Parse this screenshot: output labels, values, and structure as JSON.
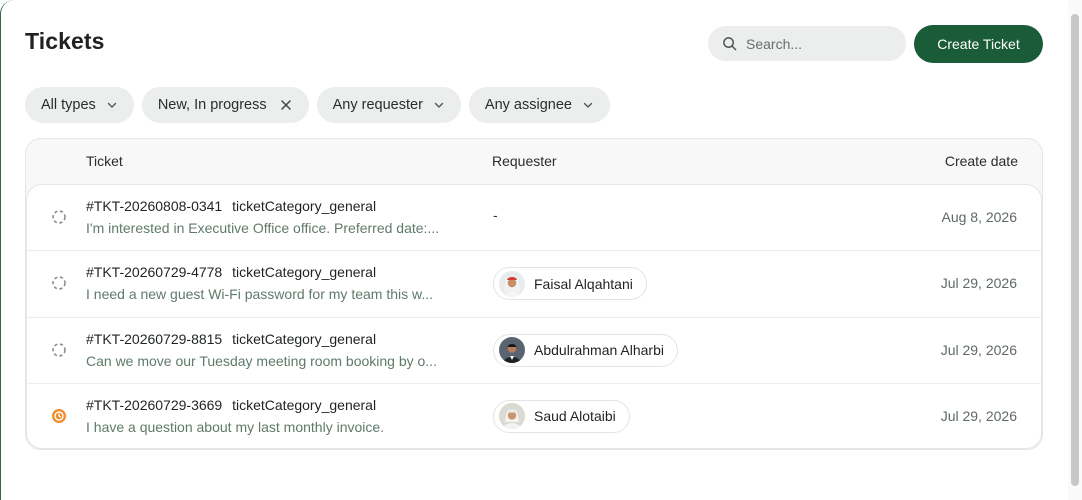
{
  "header": {
    "title": "Tickets",
    "search_placeholder": "Search...",
    "create_label": "Create Ticket"
  },
  "filters": [
    {
      "label": "All types",
      "icon": "chevron-down-icon"
    },
    {
      "label": "New, In progress",
      "icon": "close-icon"
    },
    {
      "label": "Any requester",
      "icon": "chevron-down-icon"
    },
    {
      "label": "Any assignee",
      "icon": "chevron-down-icon"
    }
  ],
  "table": {
    "columns": {
      "ticket": "Ticket",
      "requester": "Requester",
      "date": "Create date"
    },
    "rows": [
      {
        "id": "#TKT-20260808-0341",
        "category": "ticketCategory_general",
        "description": "I'm interested in Executive Office office. Preferred date:...",
        "requester": "-",
        "date": "Aug 8, 2026",
        "status": "new"
      },
      {
        "id": "#TKT-20260729-4778",
        "category": "ticketCategory_general",
        "description": "I need a new guest Wi-Fi password for my team this w...",
        "requester": "Faisal Alqahtani",
        "date": "Jul 29, 2026",
        "status": "new"
      },
      {
        "id": "#TKT-20260729-8815",
        "category": "ticketCategory_general",
        "description": "Can we move our Tuesday meeting room booking by o...",
        "requester": "Abdulrahman Alharbi",
        "date": "Jul 29, 2026",
        "status": "new"
      },
      {
        "id": "#TKT-20260729-3669",
        "category": "ticketCategory_general",
        "description": "I have a question about my last monthly invoice.",
        "requester": "Saud Alotaibi",
        "date": "Jul 29, 2026",
        "status": "in-progress"
      }
    ]
  },
  "colors": {
    "accent": "#1a5c37",
    "in_progress": "#f08c2a",
    "chip_bg": "#ebeeec"
  }
}
